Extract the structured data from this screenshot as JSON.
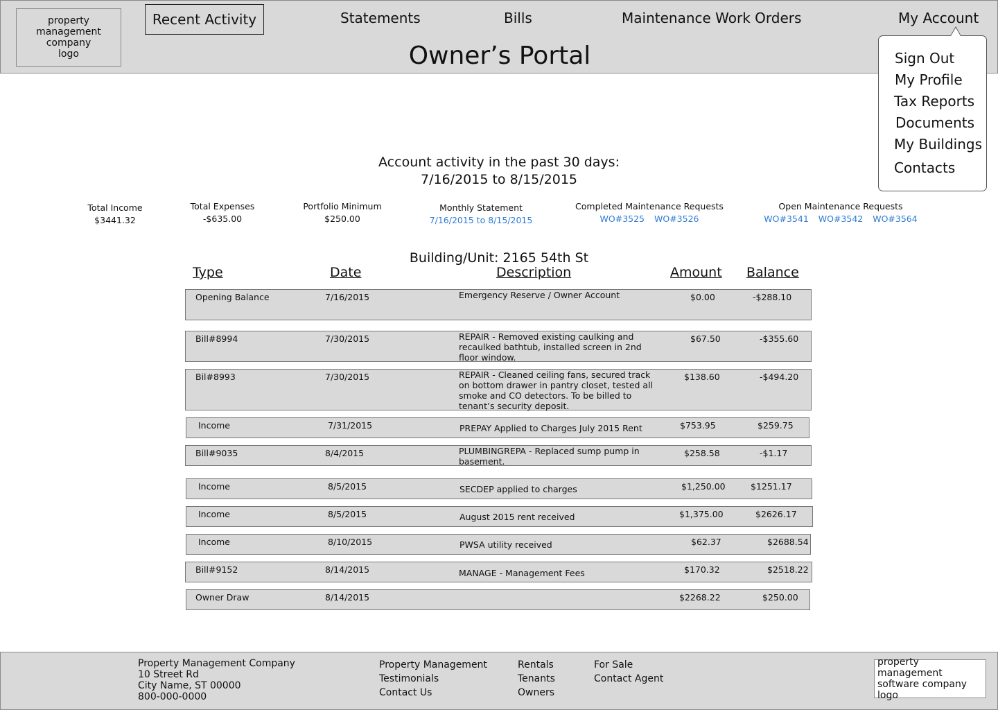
{
  "header": {
    "logo_text": "property management company logo",
    "nav": {
      "recent_activity": "Recent Activity",
      "statements": "Statements",
      "bills": "Bills",
      "work_orders": "Maintenance Work Orders",
      "my_account": "My Account"
    },
    "title": "Owner’s Portal"
  },
  "account_menu": {
    "sign_out": "Sign Out",
    "my_profile": "My Profile",
    "tax_reports": "Tax Reports",
    "documents": "Documents",
    "my_buildings": "My Buildings",
    "contacts": "Contacts"
  },
  "activity": {
    "title_line1": "Account activity in the past 30 days:",
    "title_line2": "7/16/2015 to 8/15/2015"
  },
  "stats": {
    "total_income_label": "Total Income",
    "total_income_value": "$3441.32",
    "total_expenses_label": "Total Expenses",
    "total_expenses_value": "-$635.00",
    "portfolio_minimum_label": "Portfolio Minimum",
    "portfolio_minimum_value": "$250.00",
    "monthly_statement_label": "Monthly Statement",
    "monthly_statement_link": "7/16/2015 to 8/15/2015",
    "completed_label": "Completed Maintenance Requests",
    "completed_links": [
      "WO#3525",
      "WO#3526"
    ],
    "open_label": "Open Maintenance Requests",
    "open_links": [
      "WO#3541",
      "WO#3542",
      "WO#3564"
    ]
  },
  "ledger": {
    "building": "Building/Unit: 2165 54th St",
    "columns": {
      "type": "Type",
      "date": "Date",
      "description": "Description",
      "amount": "Amount",
      "balance": "Balance"
    },
    "rows": [
      {
        "type": "Opening Balance",
        "date": "7/16/2015",
        "description": "Emergency Reserve / Owner Account",
        "amount": "$0.00",
        "balance": "-$288.10"
      },
      {
        "type": "Bill#8994",
        "date": "7/30/2015",
        "description": "REPAIR - Removed existing caulking and recaulked bathtub, installed screen in 2nd floor window.",
        "amount": "$67.50",
        "balance": "-$355.60"
      },
      {
        "type": "Bil#8993",
        "date": "7/30/2015",
        "description": "REPAIR - Cleaned ceiling fans, secured track on bottom drawer in pantry closet, tested all smoke and CO detectors. To be billed to tenant’s security deposit.",
        "amount": "$138.60",
        "balance": "-$494.20"
      },
      {
        "type": "Income",
        "date": "7/31/2015",
        "description": "PREPAY Applied to Charges July 2015 Rent",
        "amount": "$753.95",
        "balance": "$259.75"
      },
      {
        "type": "Bill#9035",
        "date": "8/4/2015",
        "description": "PLUMBINGREPA - Replaced sump pump in basement.",
        "amount": "$258.58",
        "balance": "-$1.17"
      },
      {
        "type": "Income",
        "date": "8/5/2015",
        "description": "SECDEP applied to charges",
        "amount": "$1,250.00",
        "balance": "$1251.17"
      },
      {
        "type": "Income",
        "date": "8/5/2015",
        "description": "August 2015 rent received",
        "amount": "$1,375.00",
        "balance": "$2626.17"
      },
      {
        "type": "Income",
        "date": "8/10/2015",
        "description": "PWSA utility received",
        "amount": "$62.37",
        "balance": "$2688.54"
      },
      {
        "type": "Bill#9152",
        "date": "8/14/2015",
        "description": "MANAGE - Management Fees",
        "amount": "$170.32",
        "balance": "$2518.22"
      },
      {
        "type": "Owner Draw",
        "date": "8/14/2015",
        "description": "",
        "amount": "$2268.22",
        "balance": "$250.00"
      }
    ]
  },
  "footer": {
    "company": [
      "Property Management Company",
      "10 Street Rd",
      "City Name, ST 00000",
      "800-000-0000"
    ],
    "col2": [
      "Property Management",
      "Testimonials",
      "Contact Us"
    ],
    "col3": [
      "Rentals",
      "Tenants",
      "Owners"
    ],
    "col4": [
      "For Sale",
      "Contact Agent"
    ],
    "software_logo": "property management software company logo"
  }
}
